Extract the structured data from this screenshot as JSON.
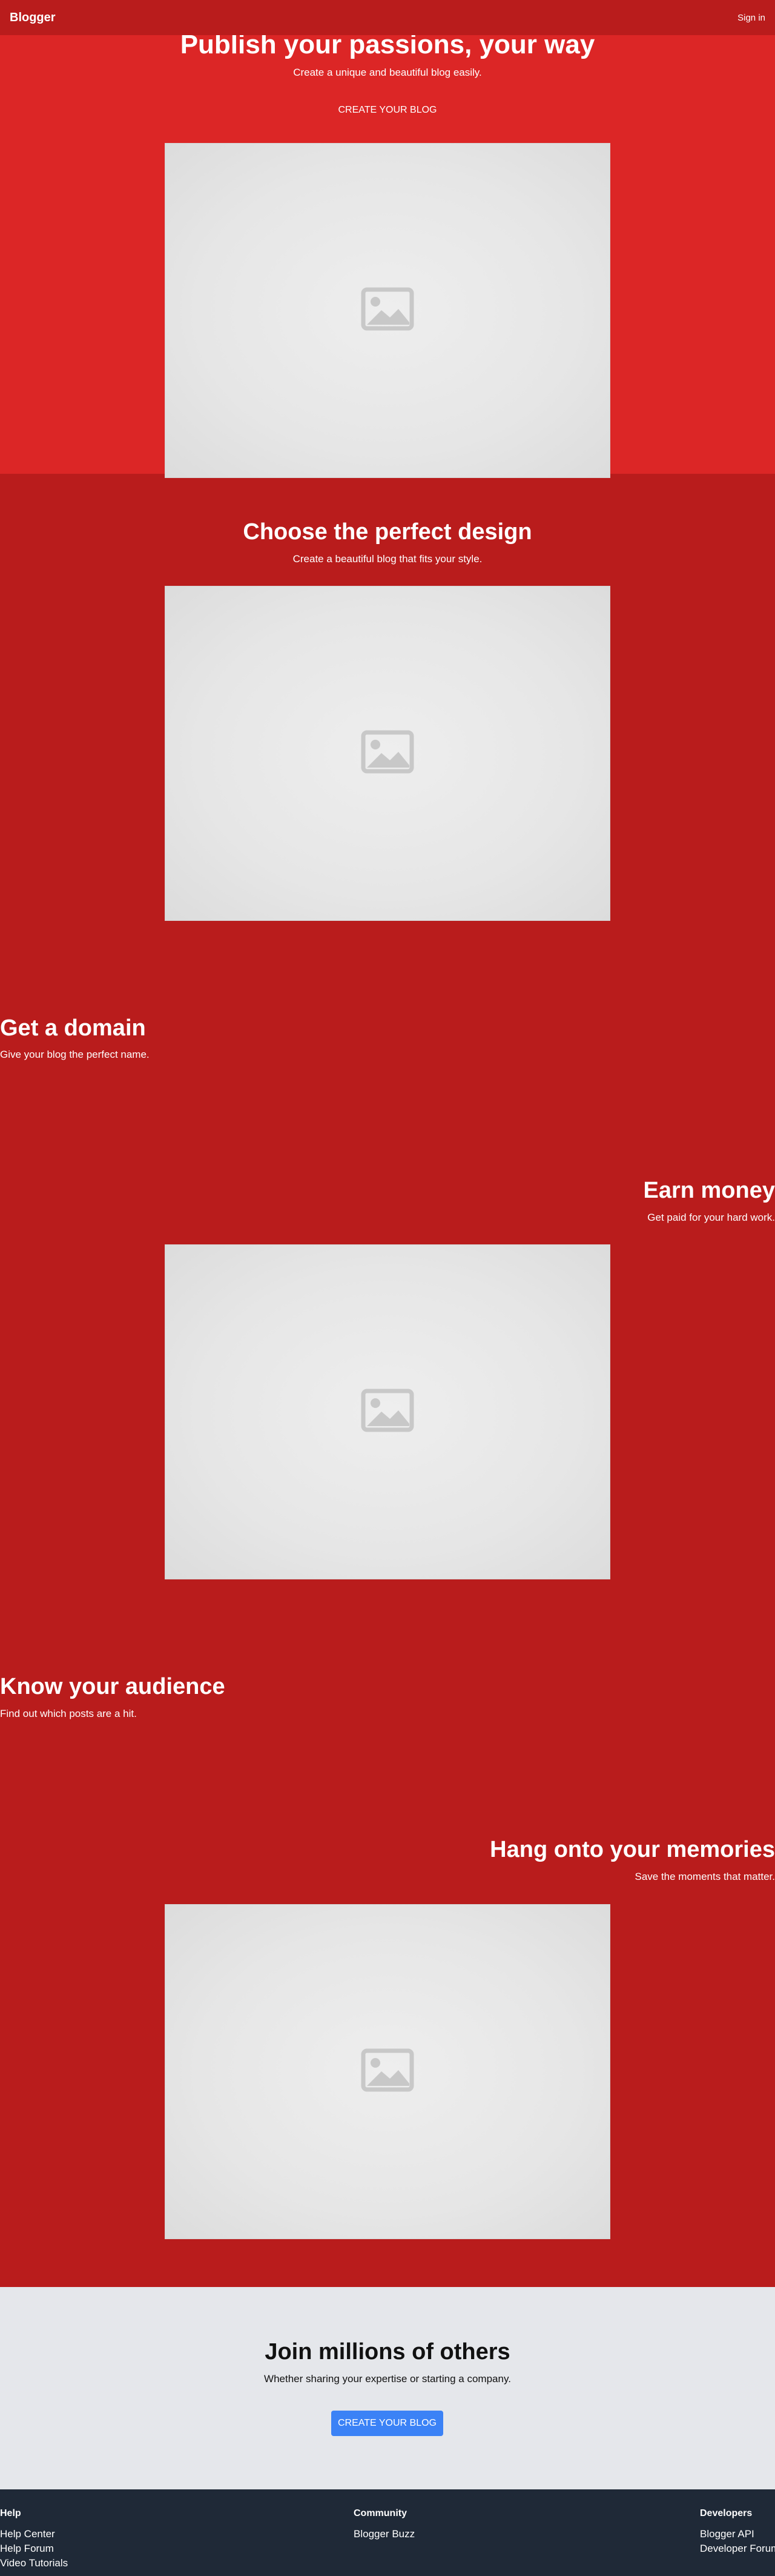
{
  "header": {
    "brand": "Blogger",
    "signin": "Sign in"
  },
  "hero": {
    "title": "Publish your passions, your way",
    "subtitle": "Create a unique and beautiful blog easily.",
    "cta": "CREATE YOUR BLOG"
  },
  "sections": {
    "design": {
      "title": "Choose the perfect design",
      "subtitle": "Create a beautiful blog that fits your style."
    },
    "domain": {
      "title": "Get a domain",
      "subtitle": "Give your blog the perfect name."
    },
    "money": {
      "title": "Earn money",
      "subtitle": "Get paid for your hard work."
    },
    "audience": {
      "title": "Know your audience",
      "subtitle": "Find out which posts are a hit."
    },
    "memories": {
      "title": "Hang onto your memories",
      "subtitle": "Save the moments that matter."
    }
  },
  "join": {
    "title": "Join millions of others",
    "subtitle": "Whether sharing your expertise or starting a company.",
    "cta": "CREATE YOUR BLOG"
  },
  "footer": {
    "help": {
      "heading": "Help",
      "links": [
        "Help Center",
        "Help Forum",
        "Video Tutorials"
      ]
    },
    "community": {
      "heading": "Community",
      "links": [
        "Blogger Buzz"
      ]
    },
    "developers": {
      "heading": "Developers",
      "links": [
        "Blogger API",
        "Developer Forum"
      ]
    }
  },
  "colors": {
    "hero_bg": "#dc2626",
    "section_bg": "#b91c1c",
    "join_bg": "#e5e7eb",
    "footer_bg": "#1f2937",
    "cta_blue": "#3b82f6"
  },
  "icons": {
    "image_placeholder": "image-placeholder-icon"
  }
}
